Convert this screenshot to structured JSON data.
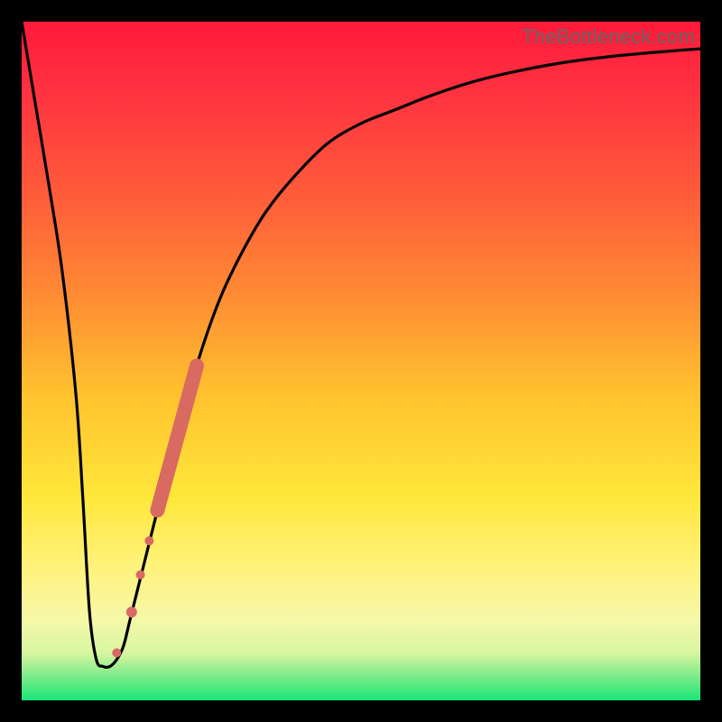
{
  "watermark": "TheBottleneck.com",
  "colors": {
    "frame": "#000000",
    "curve": "#000000",
    "marker": "#d86a62",
    "watermark": "#666666"
  },
  "gradient_stops": [
    {
      "offset": 0.0,
      "color": "#ff1a3a"
    },
    {
      "offset": 0.1,
      "color": "#ff3140"
    },
    {
      "offset": 0.25,
      "color": "#ff5a3a"
    },
    {
      "offset": 0.4,
      "color": "#ff8a34"
    },
    {
      "offset": 0.55,
      "color": "#ffc22e"
    },
    {
      "offset": 0.7,
      "color": "#ffe73a"
    },
    {
      "offset": 0.8,
      "color": "#fff27a"
    },
    {
      "offset": 0.88,
      "color": "#f6f8a8"
    },
    {
      "offset": 0.93,
      "color": "#d8f6a0"
    },
    {
      "offset": 0.965,
      "color": "#7beb8a"
    },
    {
      "offset": 1.0,
      "color": "#19e676"
    }
  ],
  "chart_data": {
    "type": "line",
    "title": "",
    "xlabel": "",
    "ylabel": "",
    "xlim": [
      0,
      100
    ],
    "ylim": [
      0,
      100
    ],
    "grid": false,
    "legend": false,
    "annotations": [],
    "series": [
      {
        "name": "bottleneck-curve",
        "x": [
          0,
          2,
          4,
          6,
          8,
          9,
          10,
          11,
          12,
          13,
          14,
          15,
          16,
          18,
          20,
          22,
          24,
          26,
          28,
          30,
          33,
          36,
          40,
          45,
          50,
          55,
          60,
          66,
          72,
          80,
          88,
          96,
          100
        ],
        "y": [
          100,
          88,
          76,
          63,
          45,
          30,
          13,
          6,
          5,
          5,
          6,
          8,
          12,
          20,
          28,
          36,
          43,
          50,
          56,
          61,
          67,
          72,
          77,
          82,
          85,
          87,
          89,
          91,
          92.5,
          94,
          95,
          95.7,
          96
        ]
      }
    ],
    "markers": [
      {
        "shape": "round-segment",
        "x0": 20.0,
        "y0": 28.0,
        "x1": 25.8,
        "y1": 49.3,
        "r": 8
      },
      {
        "shape": "circle",
        "x": 18.8,
        "y": 23.5,
        "r": 5
      },
      {
        "shape": "circle",
        "x": 17.5,
        "y": 18.5,
        "r": 5
      },
      {
        "shape": "circle",
        "x": 16.2,
        "y": 13.0,
        "r": 6
      },
      {
        "shape": "circle",
        "x": 14.0,
        "y": 7.0,
        "r": 5
      }
    ]
  }
}
